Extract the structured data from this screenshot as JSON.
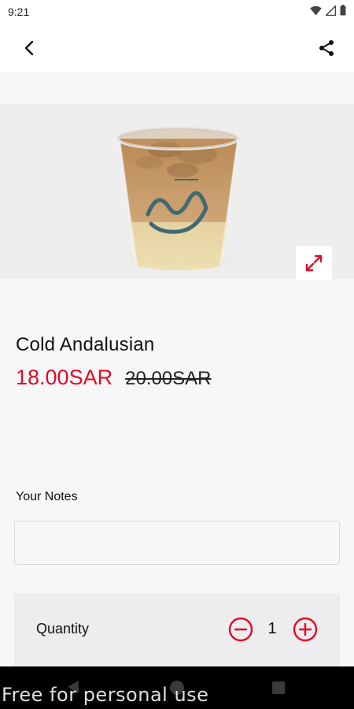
{
  "status_bar": {
    "time": "9:21"
  },
  "app_bar": {
    "back_icon": "chevron-left-icon",
    "share_icon": "share-icon"
  },
  "product": {
    "name": "Cold Andalusian",
    "price_current": "18.00SAR",
    "price_old": "20.00SAR",
    "expand_icon": "expand-icon"
  },
  "notes": {
    "label": "Your Notes",
    "value": "",
    "placeholder": ""
  },
  "quantity": {
    "label": "Quantity",
    "value": "1",
    "minus_icon": "minus-circle-icon",
    "plus_icon": "plus-circle-icon"
  },
  "watermark": "Free for personal use",
  "colors": {
    "accent": "#e30b24",
    "background": "#f7f6f8",
    "card": "#edecef"
  }
}
